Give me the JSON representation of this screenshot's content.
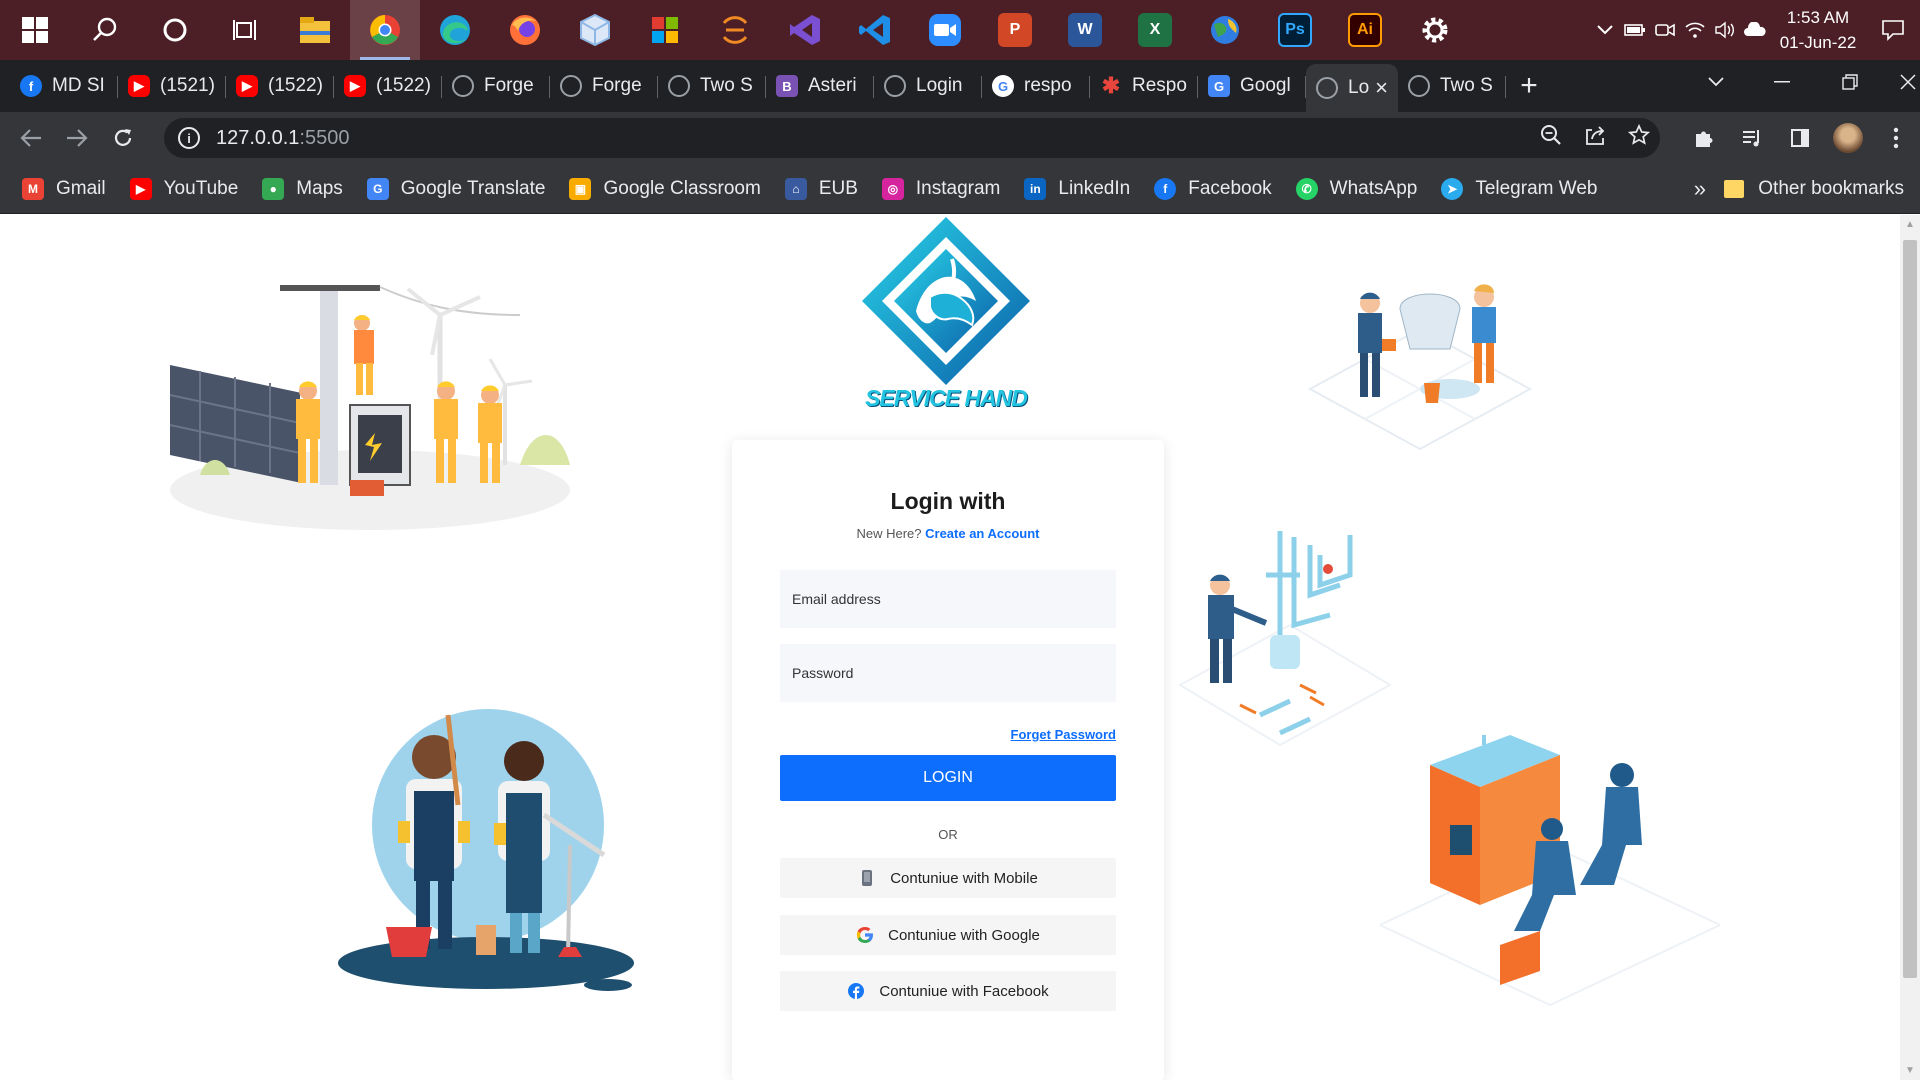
{
  "taskbar": {
    "apps": [
      {
        "icon": "windows-start-icon",
        "color": "#ffffff"
      },
      {
        "icon": "search-icon",
        "color": "#ffffff"
      },
      {
        "icon": "cortana-icon",
        "color": "#ffffff"
      },
      {
        "icon": "task-view-icon",
        "color": "#ffffff"
      },
      {
        "icon": "file-explorer-icon",
        "color": "#f3c13a"
      },
      {
        "icon": "chrome-icon",
        "color": "#e94235",
        "active": true
      },
      {
        "icon": "edge-icon",
        "color": "#1fa3d8"
      },
      {
        "icon": "firefox-icon",
        "color": "#ff7139"
      },
      {
        "icon": "virtualbox-icon",
        "color": "#8fb7e6"
      },
      {
        "icon": "office-tiles-icon",
        "color": "#e03c31"
      },
      {
        "icon": "eclipse-icon",
        "color": "#f08a24"
      },
      {
        "icon": "visual-studio-icon",
        "color": "#7b4fd1"
      },
      {
        "icon": "vscode-icon",
        "color": "#1e8ee6"
      },
      {
        "icon": "zoom-icon",
        "color": "#2d8cff"
      },
      {
        "icon": "powerpoint-icon",
        "color": "#d24726"
      },
      {
        "icon": "word-icon",
        "color": "#2b579a"
      },
      {
        "icon": "excel-icon",
        "color": "#1f7244"
      },
      {
        "icon": "globe-app-icon",
        "color": "#3fa34d"
      },
      {
        "icon": "photoshop-icon",
        "color": "#31a8ff"
      },
      {
        "icon": "illustrator-icon",
        "color": "#ff9a00"
      },
      {
        "icon": "settings-gear-icon",
        "color": "#ffffff"
      }
    ],
    "labels": {
      "ps": "Ps",
      "ai": "Ai",
      "word": "W",
      "excel": "X",
      "ppt": "P"
    },
    "clock_time": "1:53 AM",
    "clock_date": "01-Jun-22"
  },
  "tabs": [
    {
      "label": "MD SI",
      "favicon": "facebook-favicon",
      "color": "#1877f2"
    },
    {
      "label": "(1521)",
      "favicon": "youtube-favicon",
      "color": "#ff0000"
    },
    {
      "label": "(1522)",
      "favicon": "youtube-favicon",
      "color": "#ff0000"
    },
    {
      "label": "(1522)",
      "favicon": "youtube-favicon",
      "color": "#ff0000"
    },
    {
      "label": "Forge",
      "favicon": "globe-favicon",
      "color": "#9aa0a6"
    },
    {
      "label": "Forge",
      "favicon": "globe-favicon",
      "color": "#9aa0a6"
    },
    {
      "label": "Two S",
      "favicon": "globe-favicon",
      "color": "#9aa0a6"
    },
    {
      "label": "Asteri",
      "favicon": "bootstrap-favicon",
      "color": "#7952b3"
    },
    {
      "label": "Login",
      "favicon": "globe-favicon",
      "color": "#9aa0a6"
    },
    {
      "label": "respo",
      "favicon": "google-favicon",
      "color": "#ffffff"
    },
    {
      "label": "Respo",
      "favicon": "asterisk-favicon",
      "color": "#e8453c"
    },
    {
      "label": "Googl",
      "favicon": "google-translate-favicon",
      "color": "#4285f4"
    },
    {
      "label": "Lo",
      "favicon": "globe-favicon",
      "color": "#9aa0a6",
      "active": true
    },
    {
      "label": "Two S",
      "favicon": "globe-favicon",
      "color": "#9aa0a6"
    }
  ],
  "address": {
    "host": "127.0.0.1",
    "port": ":5500"
  },
  "bookmarks": [
    {
      "label": "Gmail",
      "icon": "gmail-icon",
      "color": "#ea4335"
    },
    {
      "label": "YouTube",
      "icon": "youtube-icon",
      "color": "#ff0000"
    },
    {
      "label": "Maps",
      "icon": "maps-pin-icon",
      "color": "#34a853"
    },
    {
      "label": "Google Translate",
      "icon": "google-translate-icon",
      "color": "#4285f4"
    },
    {
      "label": "Google Classroom",
      "icon": "google-classroom-icon",
      "color": "#f9ab00"
    },
    {
      "label": "EUB",
      "icon": "university-icon",
      "color": "#3a5aa0"
    },
    {
      "label": "Instagram",
      "icon": "instagram-icon",
      "color": "#d6249f"
    },
    {
      "label": "LinkedIn",
      "icon": "linkedin-icon",
      "color": "#0a66c2"
    },
    {
      "label": "Facebook",
      "icon": "facebook-icon",
      "color": "#1877f2"
    },
    {
      "label": "WhatsApp",
      "icon": "whatsapp-icon",
      "color": "#25d366"
    },
    {
      "label": "Telegram Web",
      "icon": "telegram-icon",
      "color": "#2aabee"
    }
  ],
  "bookmarks_more": "»",
  "other_bookmarks": "Other bookmarks",
  "brand": {
    "name": "SERVICE HAND"
  },
  "login": {
    "title": "Login with",
    "new_here": "New Here?",
    "create_account": "Create an Account",
    "email_placeholder": "Email address",
    "password_placeholder": "Password",
    "forget_password": "Forget Password",
    "login_button": "LOGIN",
    "or": "OR",
    "mobile_button": "Contuniue with Mobile",
    "google_button": "Contuniue with Google",
    "facebook_button": "Contuniue with Facebook"
  }
}
